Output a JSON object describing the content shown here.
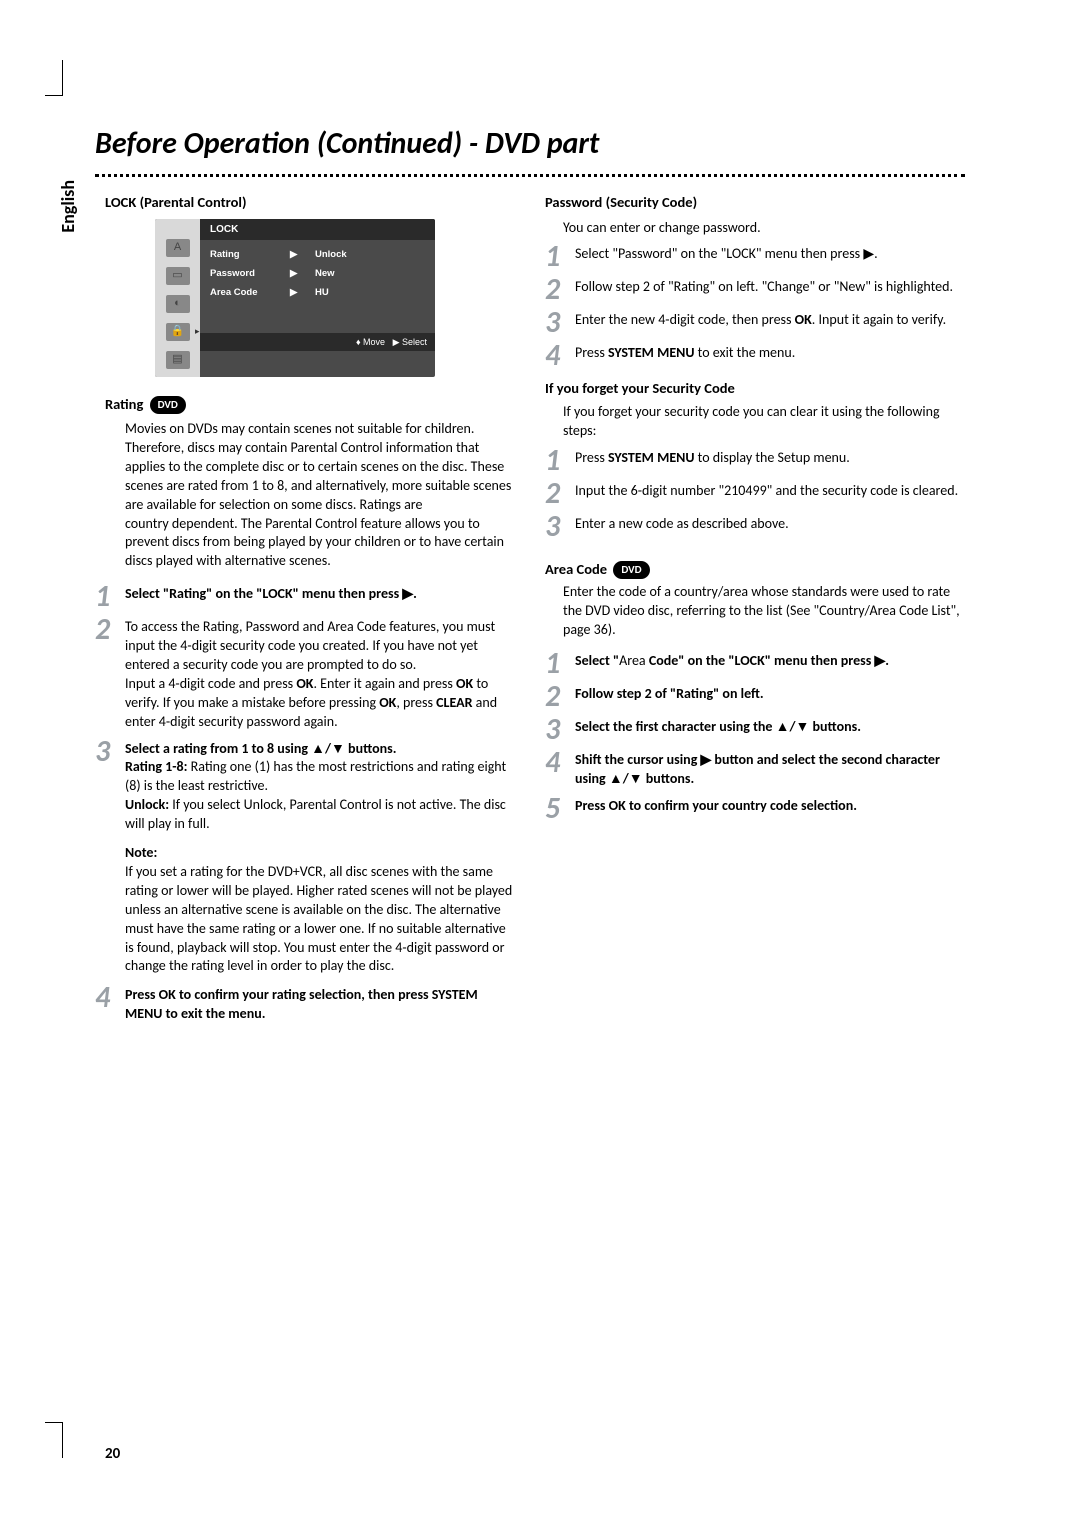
{
  "page": {
    "title": "Before Operation (Continued) - DVD part",
    "language_tab": "English",
    "page_number": "20"
  },
  "osd": {
    "title": "LOCK",
    "rows": [
      {
        "key": "Rating",
        "arrow": "▶",
        "value": "Unlock"
      },
      {
        "key": "Password",
        "arrow": "▶",
        "value": "New"
      },
      {
        "key": "Area Code",
        "arrow": "▶",
        "value": "HU"
      }
    ],
    "footer_move": "Move",
    "footer_select": "Select"
  },
  "left": {
    "section_head": "LOCK (Parental Control)",
    "rating_head": "Rating",
    "badge": "DVD",
    "rating_body": "Movies on DVDs may contain scenes not suitable for children. Therefore, discs may contain Parental Control information that applies to the complete disc or to certain scenes on the disc. These scenes are rated from 1 to 8, and alternatively, more suitable scenes are available for selection on some discs. Ratings are\ncountry dependent. The Parental Control feature allows you to prevent discs from being played by your children or to have certain discs played with alternative scenes.",
    "steps": [
      {
        "n": "1",
        "lead": "Select \"Rating\" on the \"LOCK\" menu then press ▶.",
        "body": ""
      },
      {
        "n": "2",
        "lead": "",
        "body_a": "To access the Rating, Password and Area Code features, you must input the 4-digit security code you created. If you have not yet entered a security code you are prompted to do so.",
        "body_b": "Input a 4-digit code and press OK. Enter it again and press OK to verify. If you make a mistake before pressing OK, press CLEAR and enter 4-digit security password again."
      },
      {
        "n": "3",
        "lead": "Select a rating from 1 to 8 using ▲/▼ buttons.",
        "body_a": "Rating 1-8: Rating one (1) has the most restrictions and rating eight (8) is the least restrictive.",
        "body_b": "Unlock: If you select Unlock, Parental Control is not active. The disc will play in full."
      },
      {
        "n": "4",
        "lead": "Press OK to confirm your rating selection, then press SYSTEM MENU to exit the menu.",
        "body": ""
      }
    ],
    "note_head": "Note:",
    "note_body": "If you set a rating for the DVD+VCR, all disc scenes with the same rating or lower will be played. Higher rated scenes will not be played unless an alternative scene is available on the disc. The alternative must have the same rating or a lower one. If no suitable alternative is found, playback will stop. You must enter the 4-digit password or change the rating level in order to play the disc."
  },
  "right": {
    "password_head": "Password (Security Code)",
    "password_intro": "You can enter or change password.",
    "password_steps": [
      {
        "n": "1",
        "lead": "",
        "body": "Select \"Password\" on the \"LOCK\" menu then press ▶."
      },
      {
        "n": "2",
        "lead": "",
        "body": "Follow step 2 of \"Rating\" on left. \"Change\" or \"New\" is highlighted."
      },
      {
        "n": "3",
        "lead": "",
        "body": "Enter the new 4-digit code, then press OK. Input it again to verify."
      },
      {
        "n": "4",
        "lead": "",
        "body": "Press SYSTEM MENU to exit the menu."
      }
    ],
    "forget_head": "If you forget your Security Code",
    "forget_intro": "If you forget your security code you can clear it using the following steps:",
    "forget_steps": [
      {
        "n": "1",
        "body": "Press SYSTEM MENU to display the Setup menu."
      },
      {
        "n": "2",
        "body": "Input the 6-digit number \"210499\" and the security code is cleared."
      },
      {
        "n": "3",
        "body": "Enter a new code as described above."
      }
    ],
    "area_head": "Area Code",
    "area_badge": "DVD",
    "area_intro": "Enter the code of a country/area whose standards were used to rate the DVD video disc, referring to the list (See \"Country/Area Code List\", page 36).",
    "area_steps": [
      {
        "n": "1",
        "lead": "Select \"Area Code\" on the \"LOCK\" menu then press ▶."
      },
      {
        "n": "2",
        "lead": "Follow step 2 of \"Rating\" on left."
      },
      {
        "n": "3",
        "lead": "Select the first character using the ▲/▼ buttons."
      },
      {
        "n": "4",
        "lead": "Shift the cursor using ▶ button and select the second character using ▲/▼ buttons."
      },
      {
        "n": "5",
        "lead": "Press OK to confirm your country code selection."
      }
    ]
  }
}
